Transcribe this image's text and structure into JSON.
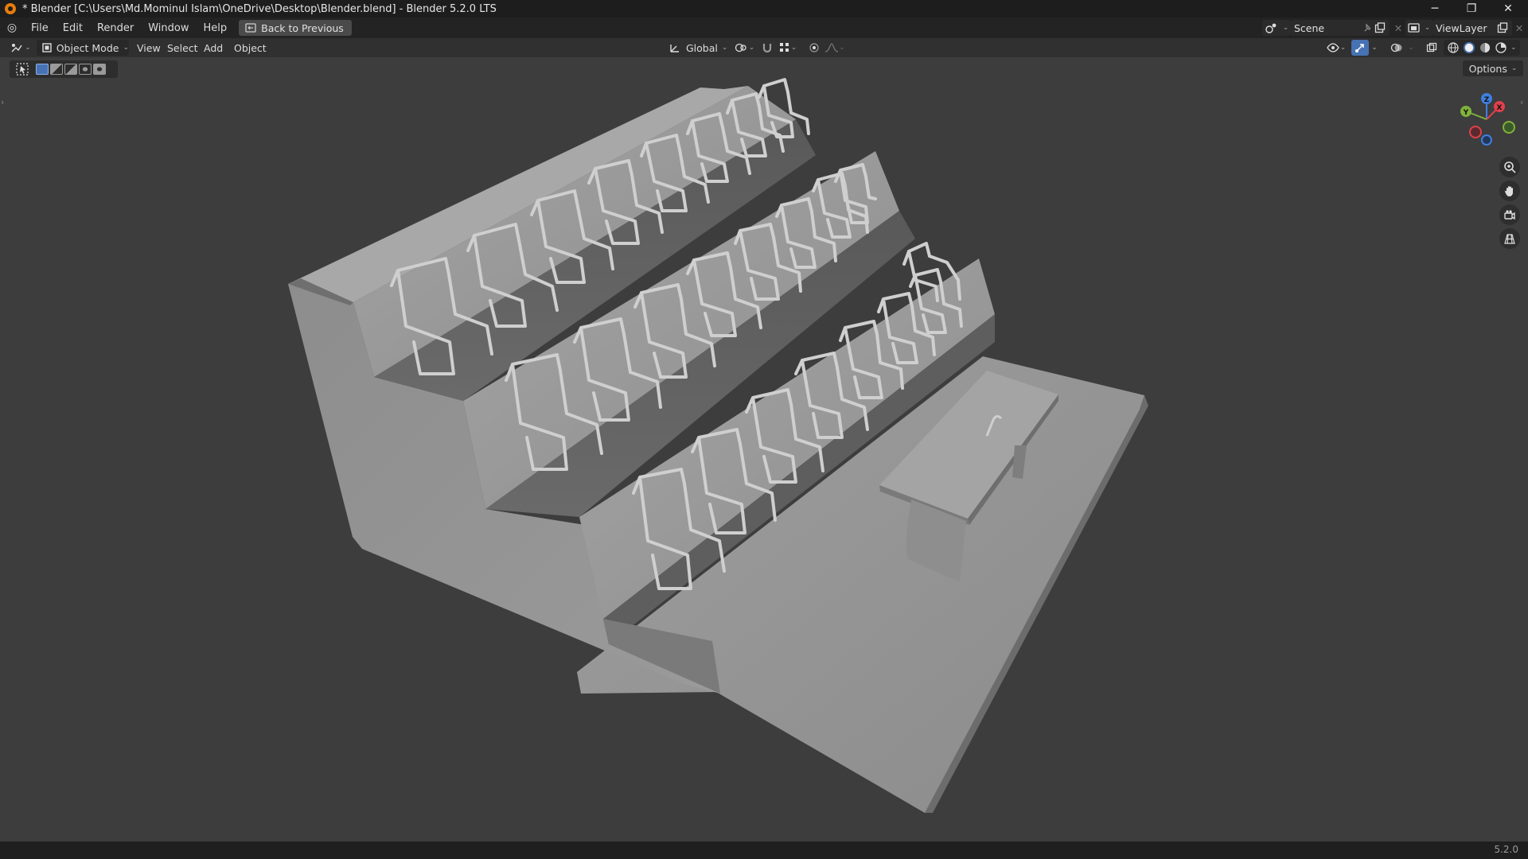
{
  "window": {
    "title": "* Blender [C:\\Users\\Md.Mominul Islam\\OneDrive\\Desktop\\Blender.blend] - Blender 5.2.0 LTS",
    "minimize_glyph": "─",
    "maximize_glyph": "❐",
    "close_glyph": "✕"
  },
  "menubar": {
    "items": [
      "File",
      "Edit",
      "Render",
      "Window",
      "Help"
    ],
    "back_button": "Back to Previous",
    "scene": "Scene",
    "view_layer": "ViewLayer"
  },
  "viewport_header": {
    "mode": "Object Mode",
    "menus": [
      "View",
      "Select",
      "Add",
      "Object"
    ],
    "transform_orientation": "Global"
  },
  "toolbar": {
    "options_label": "Options",
    "options_chevron": "⌄"
  },
  "gizmo": {
    "x_label": "X",
    "y_label": "Y",
    "z_label": "Z",
    "colors": {
      "x": "#e0404b",
      "y": "#7fb23a",
      "z": "#3f7fe0"
    }
  },
  "navigation": {
    "zoom_icon": "zoom-icon",
    "pan_icon": "hand-icon",
    "camera_icon": "camera-icon",
    "ortho_icon": "grid-icon"
  },
  "statusbar": {
    "version": "5.2.0"
  },
  "theme": {
    "accent": "#4772b3",
    "viewport_bg": "#3d3d3d",
    "model_color": "#9a9a9a"
  }
}
